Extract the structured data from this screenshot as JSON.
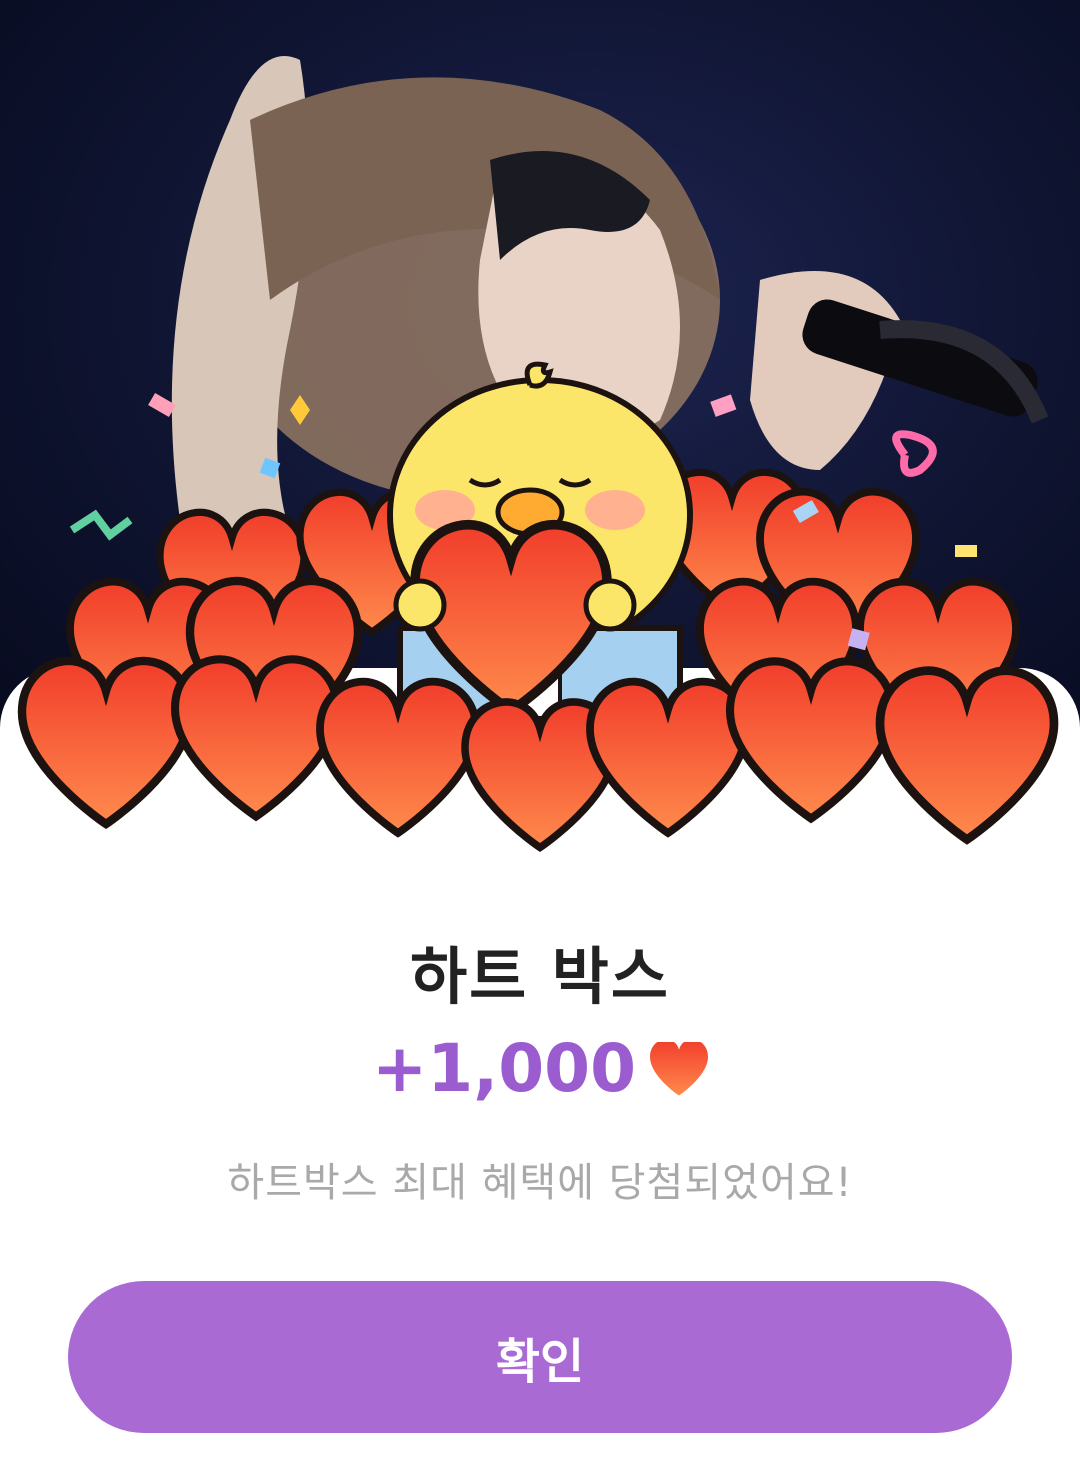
{
  "popup": {
    "title": "하트 박스",
    "reward_amount": "+1,000",
    "reward_icon": "heart-icon",
    "message": "하트박스 최대 혜택에 당첨되었어요!",
    "confirm_label": "확인"
  },
  "colors": {
    "accent": "#a96ad4",
    "reward_text": "#9b5ccf",
    "heart": "#f04a2a",
    "background_dark": "#0f1431"
  }
}
